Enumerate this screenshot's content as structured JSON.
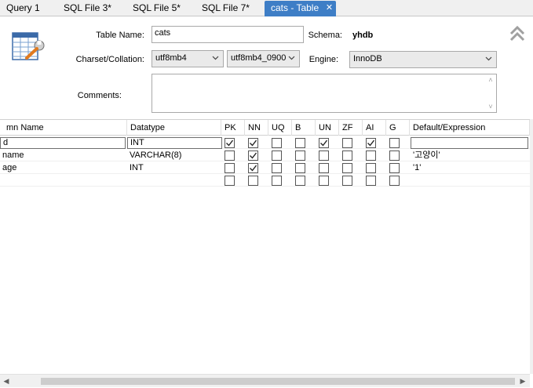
{
  "tabs": [
    {
      "label": "Query 1",
      "active": false
    },
    {
      "label": "SQL File 3*",
      "active": false
    },
    {
      "label": "SQL File 5*",
      "active": false
    },
    {
      "label": "SQL File 7*",
      "active": false
    },
    {
      "label": "cats - Table",
      "active": true
    }
  ],
  "form": {
    "table_name_label": "Table Name:",
    "table_name_value": "cats",
    "schema_label": "Schema:",
    "schema_value": "yhdb",
    "charset_label": "Charset/Collation:",
    "charset_value": "utf8mb4",
    "collation_value": "utf8mb4_0900",
    "engine_label": "Engine:",
    "engine_value": "InnoDB",
    "comments_label": "Comments:",
    "comments_value": ""
  },
  "grid": {
    "headers": [
      "mn Name",
      "Datatype",
      "PK",
      "NN",
      "UQ",
      "B",
      "UN",
      "ZF",
      "AI",
      "G",
      "Default/Expression"
    ],
    "rows": [
      {
        "name": "d",
        "datatype": "INT",
        "flags": [
          true,
          true,
          false,
          false,
          true,
          false,
          true,
          false
        ],
        "default": "",
        "editing": true
      },
      {
        "name": "name",
        "datatype": "VARCHAR(8)",
        "flags": [
          false,
          true,
          false,
          false,
          false,
          false,
          false,
          false
        ],
        "default": "'고양이'",
        "editing": false
      },
      {
        "name": "age",
        "datatype": "INT",
        "flags": [
          false,
          true,
          false,
          false,
          false,
          false,
          false,
          false
        ],
        "default": "'1'",
        "editing": false
      },
      {
        "name": "",
        "datatype": "",
        "flags": [
          false,
          false,
          false,
          false,
          false,
          false,
          false,
          false
        ],
        "default": "",
        "editing": false
      }
    ]
  },
  "colors": {
    "active_tab": "#3e7ec6",
    "border": "#a9a9a9"
  },
  "icons": {
    "table_editor": "table-wrench-icon",
    "collapse": "double-chevron-up-icon"
  }
}
